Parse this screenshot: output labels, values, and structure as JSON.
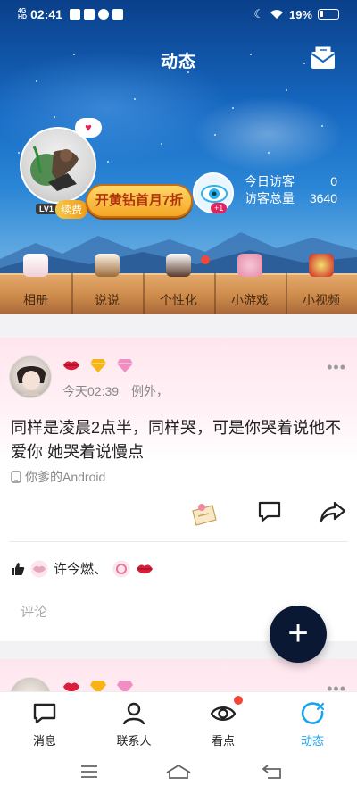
{
  "status_bar": {
    "signal": "4G",
    "signal_sub": "HD",
    "time": "02:41",
    "battery": "19%"
  },
  "header": {
    "title": "动态",
    "mail_icon": "mail-icon"
  },
  "profile": {
    "level_badge": "LV1",
    "renew_label": "续费",
    "promo_label": "开黄钻首月7折",
    "visitor_plus": "+1",
    "today_visitors_label": "今日访客",
    "today_visitors_value": "0",
    "total_visitors_label": "访客总量",
    "total_visitors_value": "3640"
  },
  "shelf": {
    "items": [
      {
        "label": "相册",
        "icon": "album-icon"
      },
      {
        "label": "说说",
        "icon": "mood-icon"
      },
      {
        "label": "个性化",
        "icon": "personalize-icon"
      },
      {
        "label": "小游戏",
        "icon": "game-icon"
      },
      {
        "label": "小视频",
        "icon": "video-icon"
      }
    ]
  },
  "post": {
    "time": "今天02:39",
    "author": "例外，",
    "text": "同样是凌晨2点半，同样哭，可是你哭着说他不爱你 她哭着说慢点",
    "device": "你爹的Android",
    "likers": "许今燃、",
    "comment_placeholder": "评论"
  },
  "fab": {
    "label": "+"
  },
  "tabbar": {
    "tabs": [
      {
        "label": "消息",
        "icon": "message-icon"
      },
      {
        "label": "联系人",
        "icon": "contacts-icon"
      },
      {
        "label": "看点",
        "icon": "eye-icon"
      },
      {
        "label": "动态",
        "icon": "feed-icon"
      }
    ]
  },
  "colors": {
    "accent": "#1ca3f0",
    "fab": "#0b1834",
    "notify": "#f2473a"
  }
}
